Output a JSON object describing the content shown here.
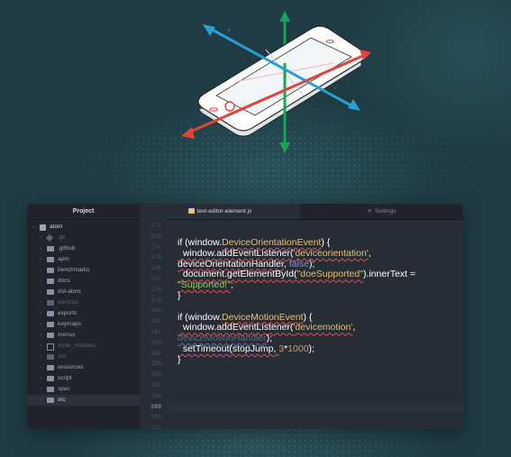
{
  "colors": {
    "background": "#1f3c45",
    "axis_green": "#1aa352",
    "axis_blue": "#2a9fd6",
    "axis_red": "#e0443a",
    "editor_bg": "#282c34",
    "tree_bg": "#21252b",
    "string": "#e5c07b",
    "string_green": "#98c379",
    "keyword": "#7f97c8",
    "number": "#d19a66"
  },
  "illustration": {
    "name": "phone-axes-illustration",
    "axes": [
      "x-axis",
      "y-axis",
      "z-axis"
    ]
  },
  "tree_view": {
    "header": "Project",
    "root": "atom",
    "items": [
      {
        "label": ".git",
        "icon": "git-icon",
        "dim": true
      },
      {
        "label": ".github",
        "icon": "folder-icon",
        "dim": false
      },
      {
        "label": "apm",
        "icon": "folder-icon",
        "dim": false
      },
      {
        "label": "benchmarks",
        "icon": "folder-icon",
        "dim": false
      },
      {
        "label": "docs",
        "icon": "folder-icon",
        "dim": false
      },
      {
        "label": "dot-atom",
        "icon": "folder-icon",
        "dim": false
      },
      {
        "label": "electron",
        "icon": "folder-icon",
        "dim": true
      },
      {
        "label": "exports",
        "icon": "folder-icon",
        "dim": false
      },
      {
        "label": "keymaps",
        "icon": "folder-icon",
        "dim": false
      },
      {
        "label": "menus",
        "icon": "folder-icon",
        "dim": false
      },
      {
        "label": "node_modules",
        "icon": "package-icon",
        "dim": true
      },
      {
        "label": "out",
        "icon": "folder-icon",
        "dim": true
      },
      {
        "label": "resources",
        "icon": "folder-icon",
        "dim": false
      },
      {
        "label": "script",
        "icon": "folder-icon",
        "dim": false
      },
      {
        "label": "spec",
        "icon": "folder-icon",
        "dim": false
      },
      {
        "label": "src",
        "icon": "folder-icon",
        "dim": false,
        "selected": true
      }
    ]
  },
  "tabs": [
    {
      "label": "text-editor-element.js",
      "active": true,
      "icon": "js-file-icon"
    },
    {
      "label": "Settings",
      "active": false,
      "icon": "tools-icon"
    }
  ],
  "gutter": {
    "line_numbers": [
      "272",
      "273",
      "274",
      "275",
      "276",
      "277",
      "278",
      "279",
      "280",
      "281",
      "282",
      "283",
      "284",
      "285",
      "286",
      "287",
      "288",
      "289",
      "290",
      "291"
    ],
    "current_line": "289"
  },
  "code": {
    "l1_a": "if (window.",
    "l1_b": "DeviceOrientationEvent",
    "l1_c": ") {",
    "l2_a": "  window.addEventListener(",
    "l2_b": "'deviceorientation'",
    "l2_c": ",",
    "l3_a": "deviceOrientationHandler",
    "l3_b": ", ",
    "l3_c": "false",
    "l3_d": ");",
    "l4_a": "  document.getElementById(",
    "l4_b": "\"doeSupported\"",
    "l4_c": ").innerText =",
    "l5_a": "\"Supported!\"",
    "l5_b": ";",
    "l6": "}",
    "l7_a": "if (window.",
    "l7_b": "DeviceMotionEvent",
    "l7_c": ") {",
    "l8_a": "  window.addEventListener(",
    "l8_b": "'devicemotion'",
    "l8_c": ",",
    "l9_a": "deviceMotionHandler",
    "l9_b": ");",
    "l10_a": "  setTimeout(stopJump, ",
    "l10_b": "3",
    "l10_c": "*",
    "l10_d": "1000",
    "l10_e": ");",
    "l11": "}"
  }
}
